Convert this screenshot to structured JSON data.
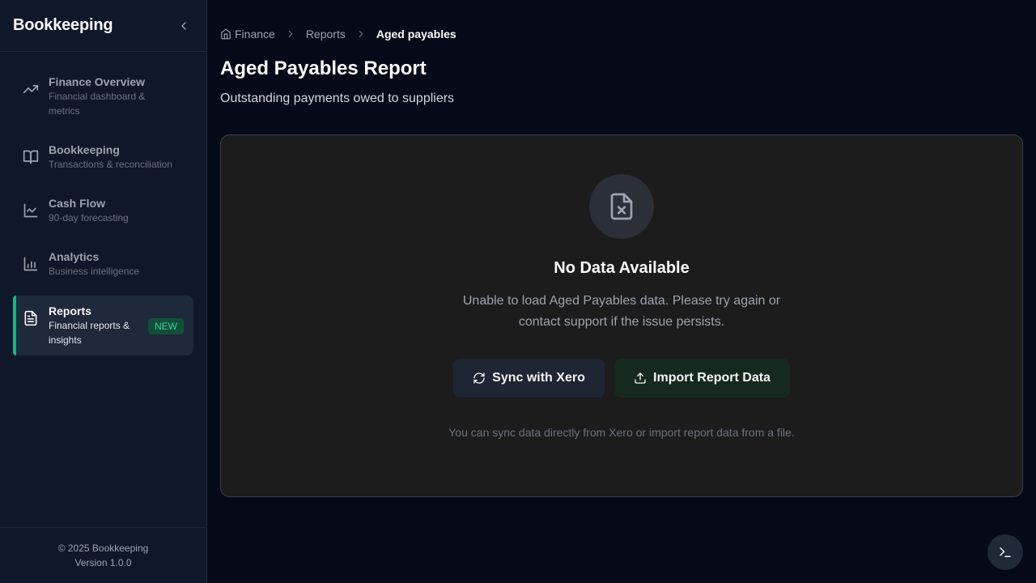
{
  "sidebar": {
    "title": "Bookkeeping",
    "items": [
      {
        "label": "Finance Overview",
        "sub": "Financial dashboard & metrics",
        "icon": "trending-up-icon"
      },
      {
        "label": "Bookkeeping",
        "sub": "Transactions & reconciliation",
        "icon": "book-open-icon"
      },
      {
        "label": "Cash Flow",
        "sub": "90-day forecasting",
        "icon": "line-chart-icon"
      },
      {
        "label": "Analytics",
        "sub": "Business intelligence",
        "icon": "bar-chart-icon"
      },
      {
        "label": "Reports",
        "sub": "Financial reports & insights",
        "icon": "file-text-icon",
        "badge": "NEW",
        "active": true
      }
    ],
    "footer": {
      "copyright": "© 2025 Bookkeeping",
      "version": "Version 1.0.0"
    }
  },
  "breadcrumb": [
    "Finance",
    "Reports",
    "Aged payables"
  ],
  "page": {
    "title": "Aged Payables Report",
    "subtitle": "Outstanding payments owed to suppliers"
  },
  "empty_state": {
    "icon": "file-x-icon",
    "title": "No Data Available",
    "description": "Unable to load Aged Payables data. Please try again or contact support if the issue persists.",
    "sync_label": "Sync with Xero",
    "import_label": "Import Report Data",
    "hint": "You can sync data directly from Xero or import report data from a file."
  },
  "colors": {
    "accent": "#10b981",
    "background": "#050a18",
    "sidebar": "#0f172a",
    "card": "#1c1c1c"
  }
}
